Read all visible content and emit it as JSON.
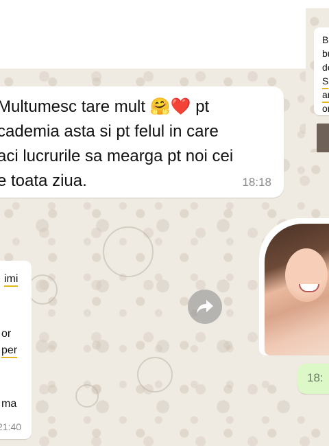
{
  "messages": {
    "incoming_main": {
      "lines": [
        "Multumesc tare mult",
        "cademia asta si pt felul in care",
        "aci lucrurile sa mearga pt noi cei",
        "e toata ziua."
      ],
      "emoji_hug": "🤗",
      "emoji_heart": "❤️",
      "line1_tail": "pt",
      "time": "18:18"
    },
    "incoming_right_fragment": {
      "lines": [
        "B",
        "bu",
        "de",
        "S",
        "ar",
        "or"
      ]
    },
    "incoming_left_fragment": {
      "lines": [
        "imi",
        "or",
        "per",
        "ma"
      ],
      "time": "21:40"
    },
    "outgoing": {
      "time_partial": "18:"
    }
  },
  "icons": {
    "forward": "forward-icon",
    "sticker": "sticker-photo"
  },
  "colors": {
    "wallpaper": "#efeae2",
    "incoming_bubble": "#ffffff",
    "outgoing_bubble": "#dcf8c6",
    "highlight": "#e3b320",
    "timestamp": "#8a8a8a"
  }
}
